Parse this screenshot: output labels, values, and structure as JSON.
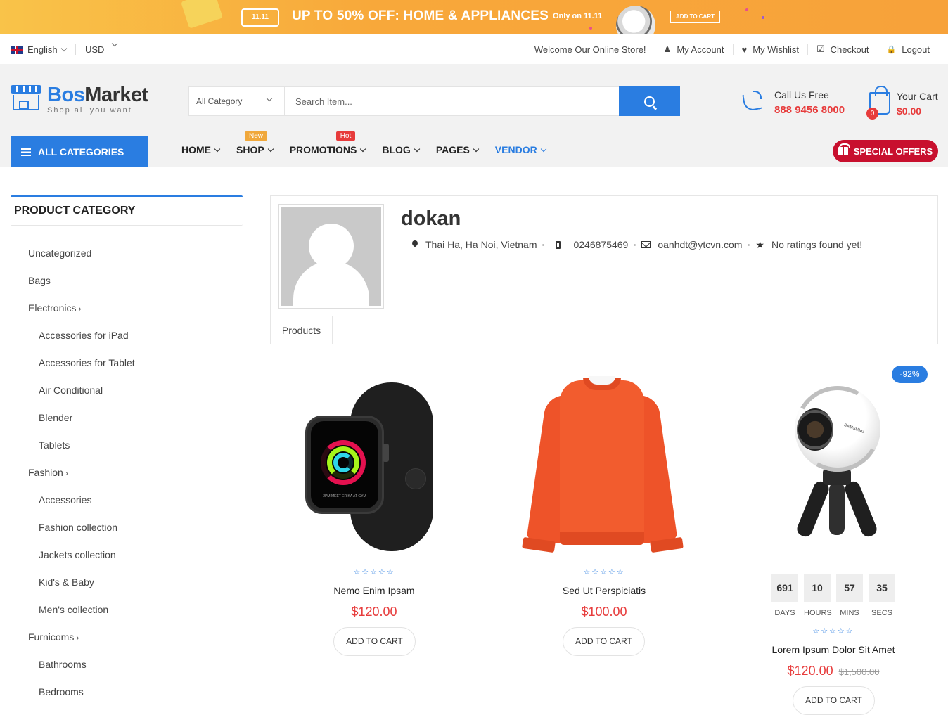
{
  "promo": {
    "tag": "11.11",
    "headline": "UP TO 50% OFF: HOME & APPLIANCES",
    "sub": "Only on 11.11",
    "button": "ADD TO CART"
  },
  "topbar": {
    "language": "English",
    "currency": "USD",
    "welcome": "Welcome Our Online Store!",
    "links": [
      {
        "label": "My Account",
        "icon": "user-icon"
      },
      {
        "label": "My Wishlist",
        "icon": "heart-icon"
      },
      {
        "label": "Checkout",
        "icon": "checkbox-icon"
      },
      {
        "label": "Logout",
        "icon": "lock-icon"
      }
    ]
  },
  "header": {
    "logo_part1": "Bos",
    "logo_part2": "Market",
    "logo_tagline": "Shop all you want",
    "search_category": "All Category",
    "search_placeholder": "Search Item...",
    "call_label": "Call Us Free",
    "call_number": "888 9456 8000",
    "cart_label": "Your Cart",
    "cart_total": "$0.00",
    "cart_count": "0"
  },
  "nav": {
    "all_categories": "ALL CATEGORIES",
    "items": [
      {
        "label": "HOME"
      },
      {
        "label": "SHOP",
        "badge": "New"
      },
      {
        "label": "PROMOTIONS",
        "badge": "Hot"
      },
      {
        "label": "BLOG"
      },
      {
        "label": "PAGES"
      },
      {
        "label": "VENDOR"
      }
    ],
    "special_offers": "SPECIAL OFFERS"
  },
  "sidebar": {
    "title": "PRODUCT CATEGORY",
    "items": [
      {
        "label": "Uncategorized",
        "level": 1
      },
      {
        "label": "Bags",
        "level": 1
      },
      {
        "label": "Electronics",
        "level": 1,
        "has_children": true
      },
      {
        "label": "Accessories for iPad",
        "level": 2
      },
      {
        "label": "Accessories for Tablet",
        "level": 2
      },
      {
        "label": "Air Conditional",
        "level": 2
      },
      {
        "label": "Blender",
        "level": 2
      },
      {
        "label": "Tablets",
        "level": 2
      },
      {
        "label": "Fashion",
        "level": 1,
        "has_children": true
      },
      {
        "label": "Accessories",
        "level": 2
      },
      {
        "label": "Fashion collection",
        "level": 2
      },
      {
        "label": "Jackets collection",
        "level": 2
      },
      {
        "label": "Kid's & Baby",
        "level": 2
      },
      {
        "label": "Men's collection",
        "level": 2
      },
      {
        "label": "Furnicoms",
        "level": 1,
        "has_children": true
      },
      {
        "label": "Bathrooms",
        "level": 2
      },
      {
        "label": "Bedrooms",
        "level": 2
      }
    ]
  },
  "store": {
    "name": "dokan",
    "address": "Thai Ha, Ha Noi, Vietnam",
    "phone": "0246875469",
    "email": "oanhdt@ytcvn.com",
    "rating": "No ratings found yet!",
    "tab": "Products"
  },
  "products": [
    {
      "name": "Nemo Enim Ipsam",
      "price": "$120.00",
      "button": "ADD TO CART",
      "stars": "☆☆☆☆☆",
      "watch_text": "2PM MEET ERIKA AT GYM"
    },
    {
      "name": "Sed Ut Perspiciatis",
      "price": "$100.00",
      "button": "ADD TO CART",
      "stars": "☆☆☆☆☆"
    },
    {
      "name": "Lorem Ipsum Dolor Sit Amet",
      "price": "$120.00",
      "old_price": "$1,500.00",
      "button": "ADD TO CART",
      "stars": "☆☆☆☆☆",
      "discount": "-92%",
      "brand": "SAMSUNG",
      "countdown": [
        {
          "value": "691",
          "label": "DAYS"
        },
        {
          "value": "10",
          "label": "HOURS"
        },
        {
          "value": "57",
          "label": "MINS"
        },
        {
          "value": "35",
          "label": "SECS"
        }
      ]
    }
  ],
  "colors": {
    "accent": "#2a7de1",
    "price": "#e73b3b",
    "special": "#c8102e",
    "badge_new": "#f0a83c"
  }
}
